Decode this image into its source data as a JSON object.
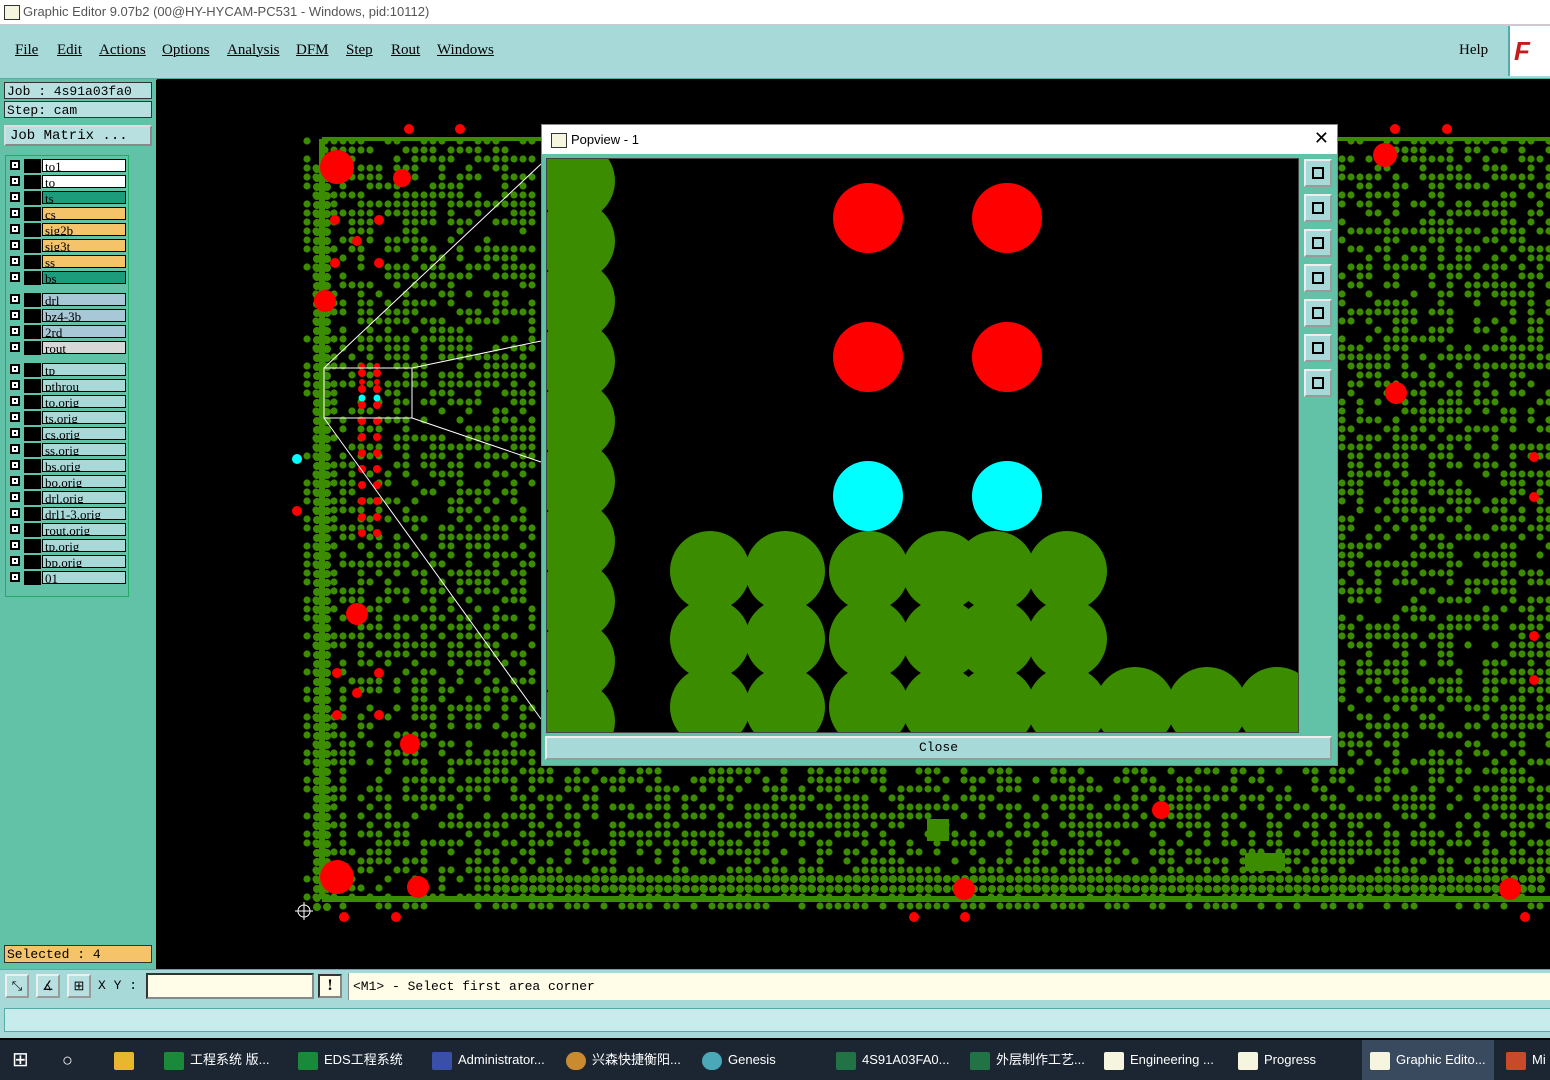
{
  "window": {
    "title": "Graphic Editor 9.07b2 (00@HY-HYCAM-PC531 - Windows, pid:10112)"
  },
  "menu": {
    "items": [
      "File",
      "Edit",
      "Actions",
      "Options",
      "Analysis",
      "DFM",
      "Step",
      "Rout",
      "Windows"
    ],
    "help": "Help",
    "logo": "F"
  },
  "left": {
    "job": "Job : 4s91a03fa0",
    "step": "Step: cam",
    "job_matrix": "Job Matrix ...",
    "selected": "Selected : 4"
  },
  "layers": [
    {
      "name": "to1",
      "color": "#ffffff"
    },
    {
      "name": "to",
      "color": "#ffffff"
    },
    {
      "name": "ts",
      "color": "#1d9c7c"
    },
    {
      "name": "cs",
      "color": "#f4c36a"
    },
    {
      "name": "sig2b",
      "color": "#f4c36a"
    },
    {
      "name": "sig3t",
      "color": "#f4c36a"
    },
    {
      "name": "ss",
      "color": "#f4c36a"
    },
    {
      "name": "bs",
      "color": "#1d9c7c"
    },
    {
      "name": "drl",
      "color": "#a8c8d8"
    },
    {
      "name": "bz4-3b",
      "color": "#a8c8d8"
    },
    {
      "name": "2rd",
      "color": "#a8c8d8"
    },
    {
      "name": "rout",
      "color": "#d8d8d8"
    },
    {
      "name": "tp",
      "color": "#a7d9d9"
    },
    {
      "name": "pthrou",
      "color": "#a7d9d9"
    },
    {
      "name": "to.orig",
      "color": "#a7d9d9"
    },
    {
      "name": "ts.orig",
      "color": "#a7d9d9"
    },
    {
      "name": "cs.orig",
      "color": "#a7d9d9"
    },
    {
      "name": "ss.orig",
      "color": "#a7d9d9"
    },
    {
      "name": "bs.orig",
      "color": "#a7d9d9"
    },
    {
      "name": "bo.orig",
      "color": "#a7d9d9"
    },
    {
      "name": "drl.orig",
      "color": "#a7d9d9"
    },
    {
      "name": "drl1-3.orig",
      "color": "#a7d9d9"
    },
    {
      "name": "rout.orig",
      "color": "#a7d9d9"
    },
    {
      "name": "tp.orig",
      "color": "#a7d9d9"
    },
    {
      "name": "bp.orig",
      "color": "#a7d9d9"
    },
    {
      "name": "01",
      "color": "#a7d9d9"
    }
  ],
  "command": {
    "xy_label": "X Y :",
    "xy_value": "",
    "bang": "!",
    "prompt": "<M1> - Select first area corner"
  },
  "popview": {
    "title": "Popview - 1",
    "close_label": "Close"
  },
  "taskbar": [
    {
      "label": "工程系统  版..."
    },
    {
      "label": "EDS工程系统"
    },
    {
      "label": "Administrator..."
    },
    {
      "label": "兴森快捷衡阳..."
    },
    {
      "label": "Genesis"
    },
    {
      "label": "4S91A03FA0..."
    },
    {
      "label": "外层制作工艺..."
    },
    {
      "label": "Engineering ..."
    },
    {
      "label": "Progress"
    },
    {
      "label": "Graphic Edito..."
    },
    {
      "label": "Mi"
    }
  ],
  "colors": {
    "pad": "#3c8c00",
    "drill": "#ff0000",
    "selected": "#00ffff",
    "panel": "#62c2a8",
    "bar": "#a7d9d9"
  }
}
